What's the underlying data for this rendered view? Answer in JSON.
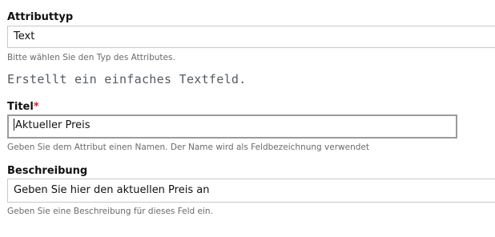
{
  "attribute_type": {
    "label": "Attributtyp",
    "value": "Text",
    "help": "Bitte wählen Sie den Typ des Attributes.",
    "type_description": "Erstellt ein einfaches Textfeld."
  },
  "title": {
    "label": "Titel",
    "required_marker": "*",
    "value": "Aktueller Preis",
    "help": "Geben Sie dem Attribut einen Namen. Der Name wird als Feldbezeichnung verwendet"
  },
  "description": {
    "label": "Beschreibung",
    "value": "Geben Sie hier den aktuellen Preis an",
    "help": "Geben Sie eine Beschreibung für dieses Feld ein."
  },
  "colors": {
    "required": "#d0232b",
    "help_text": "#6a6a6a",
    "border": "#c8c8c8",
    "focus_border": "#9b9b9b"
  }
}
